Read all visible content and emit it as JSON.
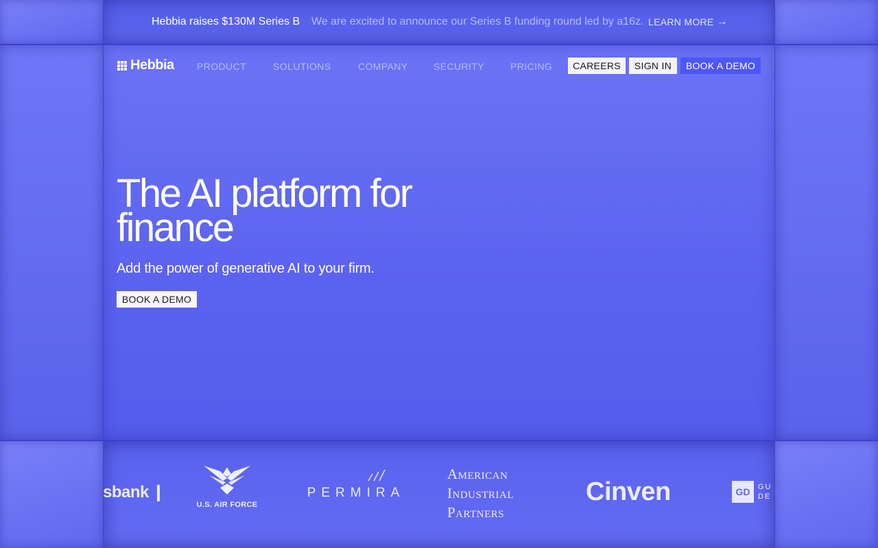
{
  "announcement": {
    "title": "Hebbia raises $130M Series B",
    "text": "We are excited to announce our Series B funding round led by a16z.",
    "link_label": "LEARN MORE",
    "link_icon": "arrow-right-icon"
  },
  "nav": {
    "logo_text": "Hebbia",
    "links": [
      "PRODUCT",
      "SOLUTIONS",
      "COMPANY",
      "SECURITY",
      "PRICING"
    ],
    "careers_label": "CAREERS",
    "signin_label": "SIGN IN",
    "demo_label": "BOOK A DEMO"
  },
  "hero": {
    "title": "The AI platform for finance",
    "subtitle": "Add the power of generative AI to your firm.",
    "cta_label": "BOOK A DEMO"
  },
  "logos": {
    "sbank": "sbank",
    "airforce": "U.S. AIR FORCE",
    "permira": "PERMIRA",
    "aip_lines": [
      "American",
      "Industrial",
      "Partners"
    ],
    "cinven": "Cinven",
    "gd_mark": "GD",
    "gd_lines": [
      "GU",
      "DE"
    ]
  },
  "colors": {
    "background": "#5a63ee",
    "accent_button": "#4d56f6",
    "light_button": "#f4f4f8"
  }
}
